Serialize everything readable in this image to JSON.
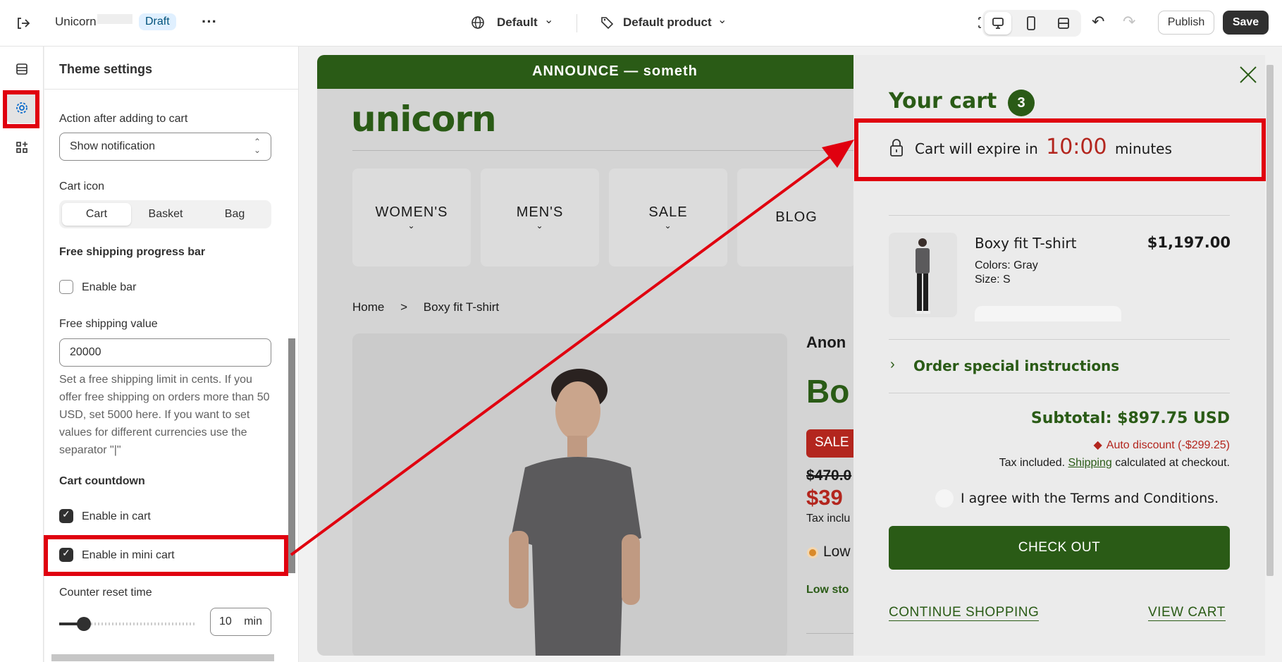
{
  "topbar": {
    "store_name": "Unicorn",
    "status_badge": "Draft",
    "theme_select": "Default",
    "template_select": "Default product",
    "publish_label": "Publish",
    "save_label": "Save"
  },
  "panel": {
    "title": "Theme settings",
    "action_label": "Action after adding to cart",
    "action_value": "Show notification",
    "cart_icon_label": "Cart icon",
    "cart_icon_options": [
      "Cart",
      "Basket",
      "Bag"
    ],
    "free_shipping_heading": "Free shipping progress bar",
    "enable_bar_label": "Enable bar",
    "enable_bar_checked": false,
    "free_shipping_value_label": "Free shipping value",
    "free_shipping_value": "20000",
    "free_shipping_help": "Set a free shipping limit in cents. If you offer free shipping on orders more than 50 USD, set 5000 here. If you want to set values for different currencies use the separator \"|\"",
    "countdown_heading": "Cart countdown",
    "enable_in_cart_label": "Enable in cart",
    "enable_in_cart_checked": true,
    "enable_in_mini_cart_label": "Enable in mini cart",
    "enable_in_mini_cart_checked": true,
    "counter_reset_label": "Counter reset time",
    "counter_reset_value": "10",
    "counter_reset_unit": "min",
    "counter_reset_slider_fraction": 0.18
  },
  "store": {
    "announcement": "ANNOUNCE — someth",
    "logo": "unicorn",
    "nav": [
      "WOMEN'S",
      "MEN'S",
      "SALE",
      "BLOG"
    ],
    "breadcrumb": [
      "Home",
      ">",
      "Boxy fit T-shirt"
    ],
    "vendor": "Anon",
    "product_title": "Bo",
    "sale_badge": "SALE",
    "compare_price": "$470.0",
    "price": "$39",
    "tax_note": "Tax inclu",
    "stock_option": "Low",
    "stock_text": "Low sto"
  },
  "cart": {
    "title": "Your cart",
    "count": "3",
    "expire_prefix": "Cart will expire in",
    "timer": "10:00",
    "expire_suffix": "minutes",
    "item": {
      "name": "Boxy fit T-shirt",
      "price": "$1,197.00",
      "color": "Colors: Gray",
      "size": "Size: S"
    },
    "instructions": "Order special instructions",
    "subtotal": "Subtotal: $897.75 USD",
    "discount": "Auto discount (-$299.25)",
    "tax_prefix": "Tax included.",
    "shipping_link": "Shipping",
    "tax_suffix": "calculated at checkout.",
    "terms": "I agree with the Terms and Conditions.",
    "checkout": "CHECK OUT",
    "continue": "CONTINUE SHOPPING",
    "view_cart": "VIEW CART"
  },
  "colors": {
    "brand_green": "#2a5b16",
    "highlight_red": "#e0000f",
    "timer_red": "#b3261e"
  }
}
